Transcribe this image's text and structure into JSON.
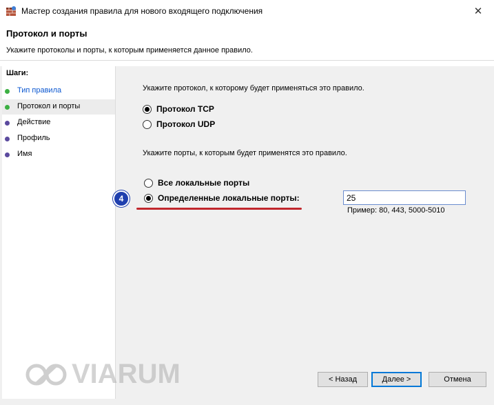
{
  "window": {
    "title": "Мастер создания правила для нового входящего подключения",
    "close_symbol": "✕"
  },
  "header": {
    "title": "Протокол и порты",
    "subtitle": "Укажите протоколы и порты, к которым применяется данное правило."
  },
  "sidebar": {
    "title": "Шаги:",
    "items": [
      {
        "label": "Тип правила",
        "dot_color": "#3cb043"
      },
      {
        "label": "Протокол и порты",
        "dot_color": "#3cb043"
      },
      {
        "label": "Действие",
        "dot_color": "#5b4a9e"
      },
      {
        "label": "Профиль",
        "dot_color": "#5b4a9e"
      },
      {
        "label": "Имя",
        "dot_color": "#5b4a9e"
      }
    ]
  },
  "main": {
    "protocol_prompt": "Укажите протокол, к которому будет применяться это правило.",
    "protocol_options": [
      {
        "label": "Протокол TCP",
        "checked": true
      },
      {
        "label": "Протокол UDP",
        "checked": false
      }
    ],
    "ports_prompt": "Укажите порты, к которым будет применятся это правило.",
    "port_options": [
      {
        "label": "Все локальные порты",
        "checked": false
      },
      {
        "label": "Определенные локальные порты:",
        "checked": true
      }
    ],
    "port_value": "25",
    "port_example": "Пример: 80, 443, 5000-5010",
    "step_badge": "4"
  },
  "watermark": {
    "text": "VIARUM"
  },
  "buttons": {
    "back": "< Назад",
    "next": "Далее >",
    "cancel": "Отмена"
  }
}
